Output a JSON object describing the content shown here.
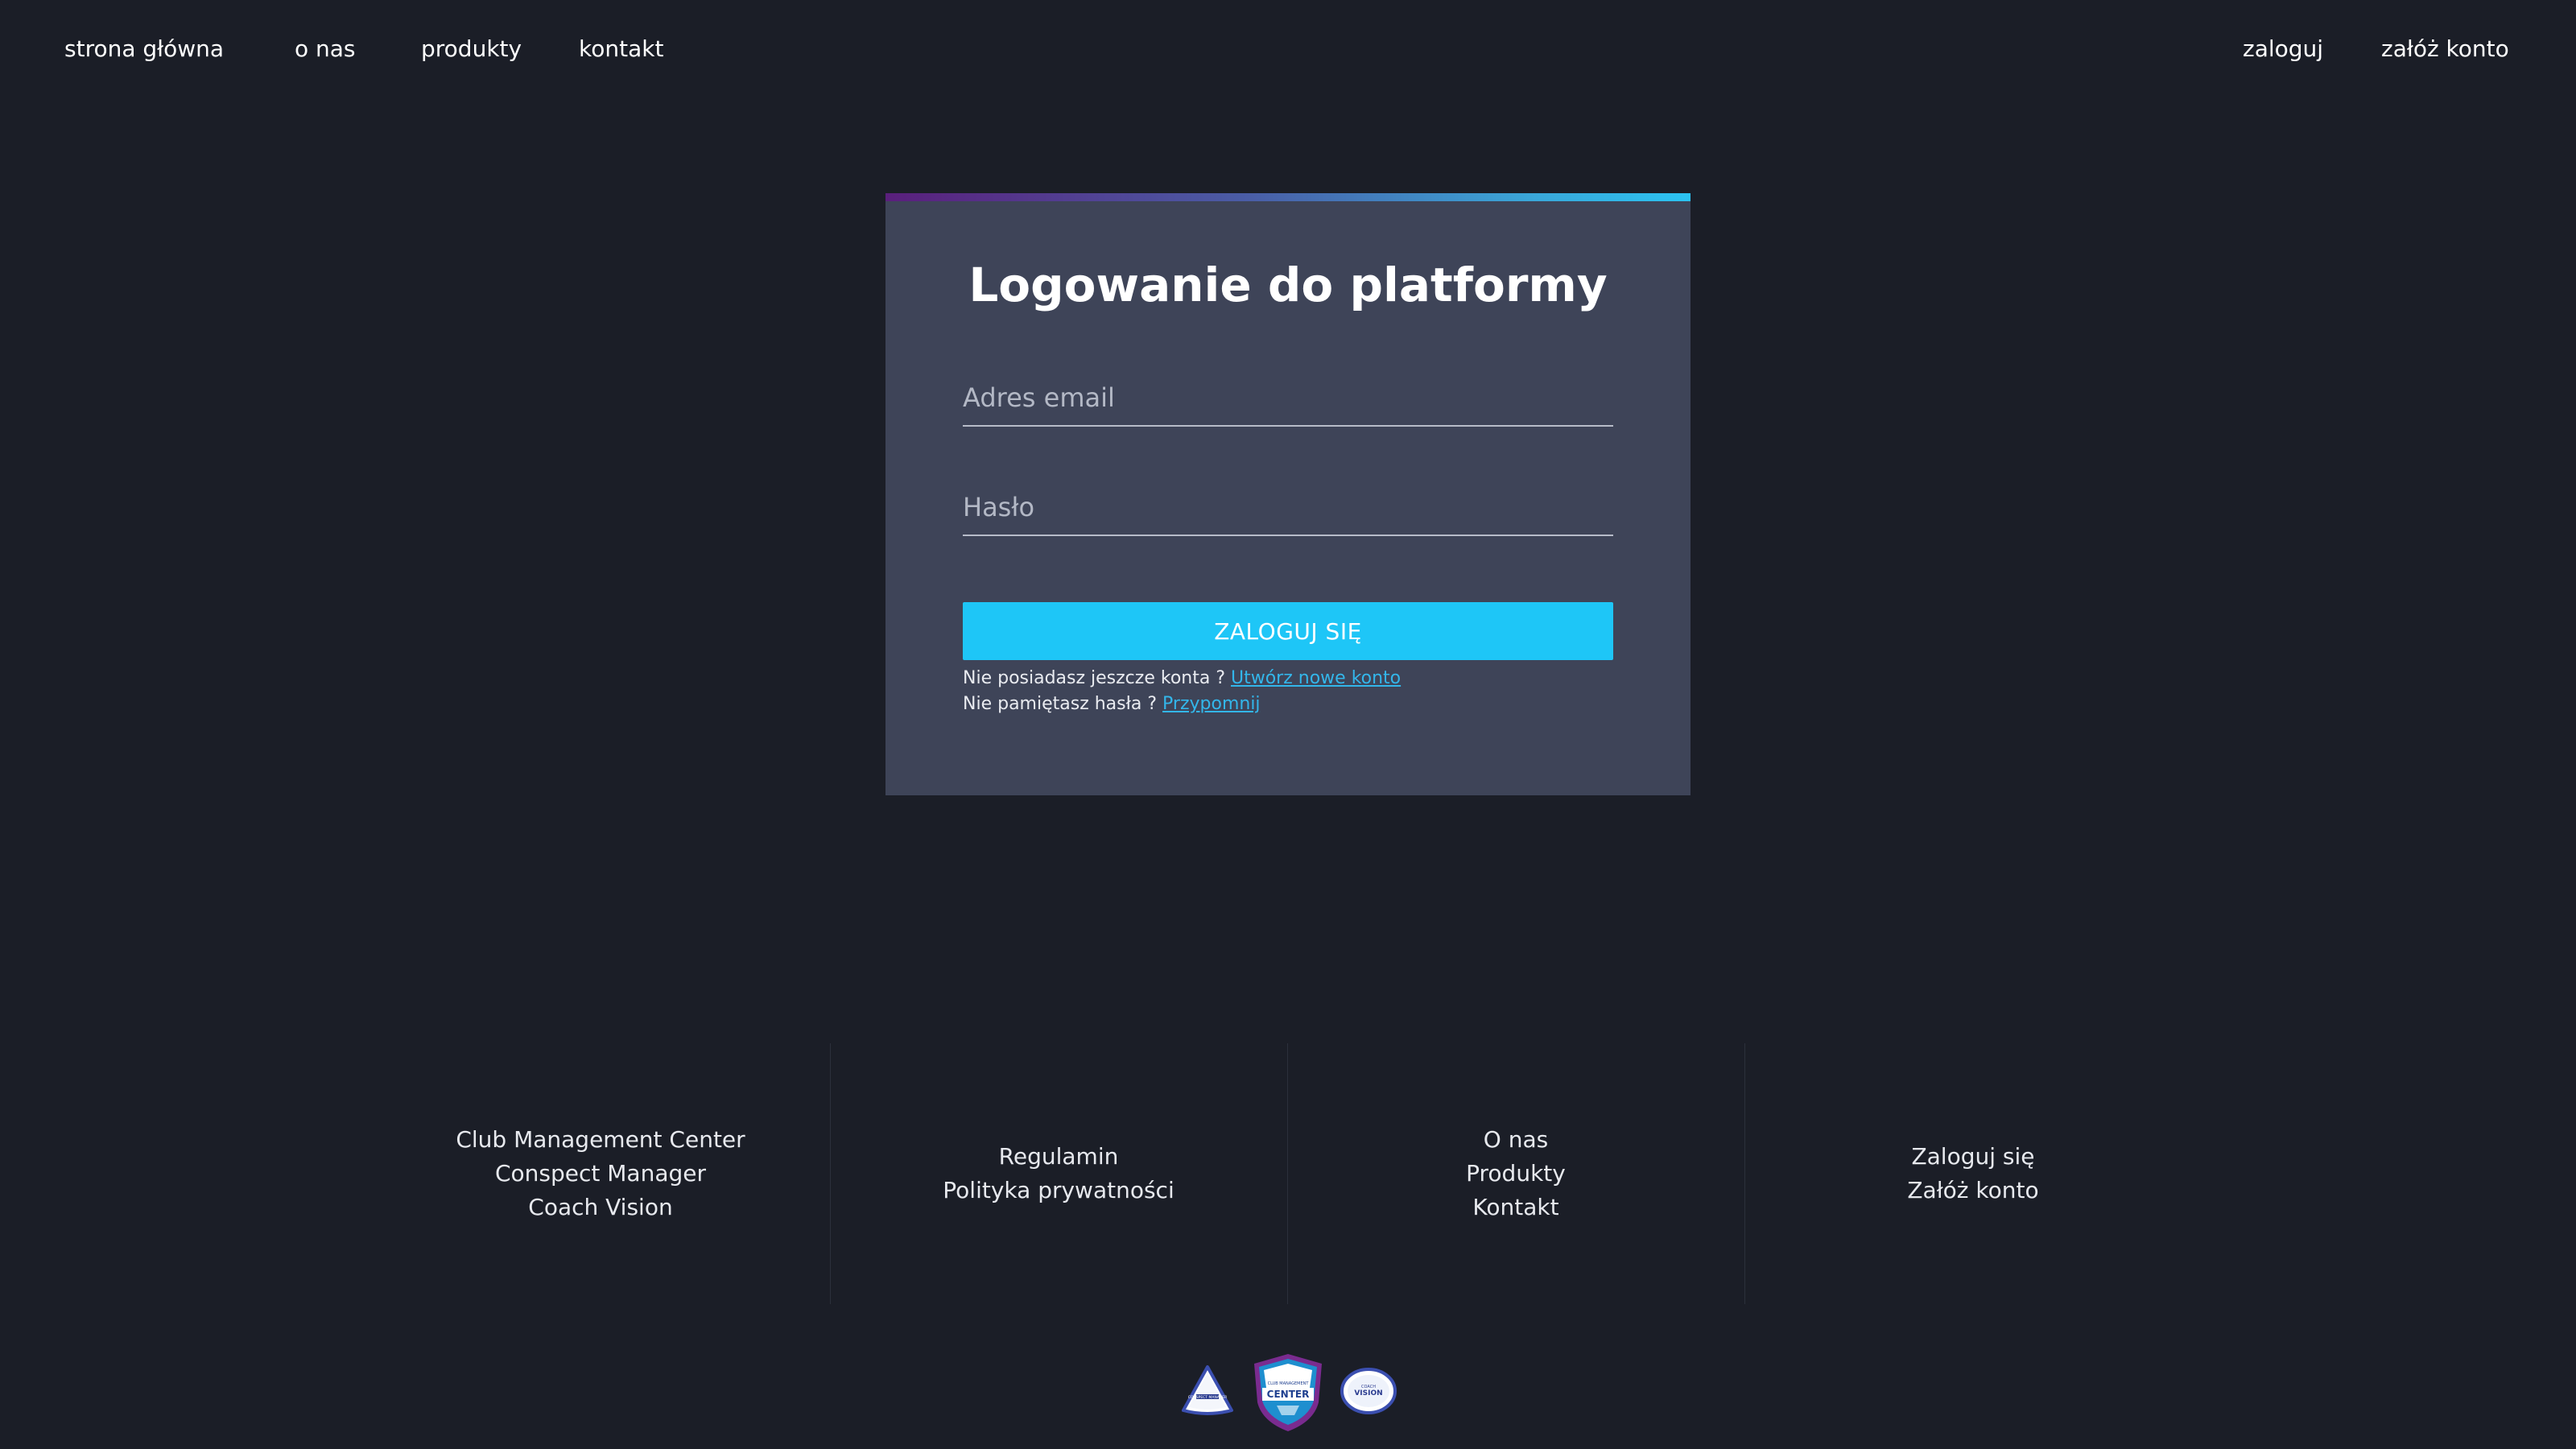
{
  "nav": {
    "left": [
      "strona główna",
      "o nas",
      "produkty",
      "kontakt"
    ],
    "right": [
      "zaloguj",
      "załóż konto"
    ]
  },
  "login": {
    "title": "Logowanie do platformy",
    "email_placeholder": "Adres email",
    "password_placeholder": "Hasło",
    "submit_label": "ZALOGUJ SIĘ",
    "no_account_text": "Nie posiadasz jeszcze konta ?",
    "create_account_link": "Utwórz nowe konto",
    "forgot_text": "Nie pamiętasz hasła ?",
    "remind_link": "Przypomnij"
  },
  "footer": {
    "products": [
      "Club Management Center",
      "Conspect Manager",
      "Coach Vision"
    ],
    "legal": [
      "Regulamin",
      "Polityka prywatności"
    ],
    "company": [
      "O nas",
      "Produkty",
      "Kontakt"
    ],
    "account": [
      "Zaloguj się",
      "Załóż konto"
    ]
  },
  "badges": {
    "conspect": "CONSPECT MANAGER",
    "center": "CENTER",
    "center_small": "CLUB MANAGEMENT",
    "vision": "VISION",
    "vision_small": "COACH"
  },
  "colors": {
    "background": "#1b1e27",
    "card": "#3e4458",
    "accent": "#1ec6f7",
    "link": "#33b6ea"
  }
}
